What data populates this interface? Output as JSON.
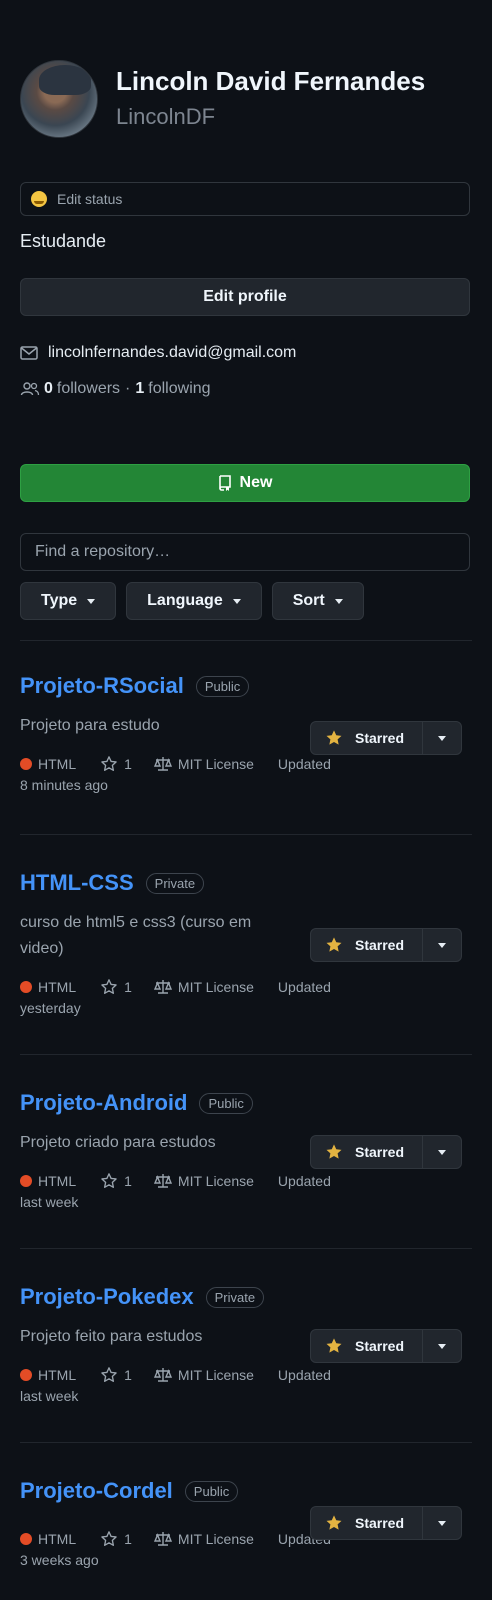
{
  "profile": {
    "display_name": "Lincoln David Fernandes",
    "username": "LincolnDF",
    "status_label": "Edit status",
    "bio": "Estudande",
    "edit_profile_label": "Edit profile",
    "email": "lincolnfernandes.david@gmail.com",
    "followers_count": "0",
    "followers_label": "followers",
    "separator": "·",
    "following_count": "1",
    "following_label": "following"
  },
  "repo_toolbar": {
    "new_label": "New",
    "search_placeholder": "Find a repository…",
    "filters": [
      {
        "label": "Type"
      },
      {
        "label": "Language"
      },
      {
        "label": "Sort"
      }
    ]
  },
  "repositories": [
    {
      "name": "Projeto-RSocial",
      "visibility": "Public",
      "description": "Projeto para estudo",
      "language": "HTML",
      "stars": "1",
      "license": "MIT License",
      "updated_label": "Updated",
      "updated_time": "8 minutes ago",
      "starred_label": "Starred"
    },
    {
      "name": "HTML-CSS",
      "visibility": "Private",
      "description": "curso de html5 e css3 (curso em video)",
      "language": "HTML",
      "stars": "1",
      "license": "MIT License",
      "updated_label": "Updated",
      "updated_time": "yesterday",
      "starred_label": "Starred"
    },
    {
      "name": "Projeto-Android",
      "visibility": "Public",
      "description": "Projeto criado para estudos",
      "language": "HTML",
      "stars": "1",
      "license": "MIT License",
      "updated_label": "Updated",
      "updated_time": "last week",
      "starred_label": "Starred"
    },
    {
      "name": "Projeto-Pokedex",
      "visibility": "Private",
      "description": "Projeto feito para estudos",
      "language": "HTML",
      "stars": "1",
      "license": "MIT License",
      "updated_label": "Updated",
      "updated_time": "last week",
      "starred_label": "Starred"
    },
    {
      "name": "Projeto-Cordel",
      "visibility": "Public",
      "description": "",
      "language": "HTML",
      "stars": "1",
      "license": "MIT License",
      "updated_label": "Updated",
      "updated_time": "3 weeks ago",
      "starred_label": "Starred"
    }
  ],
  "colors": {
    "background": "#0d1117",
    "link": "#4493f8",
    "primary_button": "#238636",
    "html_language": "#e34c26",
    "star": "#e3b341"
  },
  "icons": {
    "email": "mail-icon",
    "followers": "people-icon",
    "new": "repo-icon",
    "star": "star-icon",
    "license": "law-icon"
  }
}
